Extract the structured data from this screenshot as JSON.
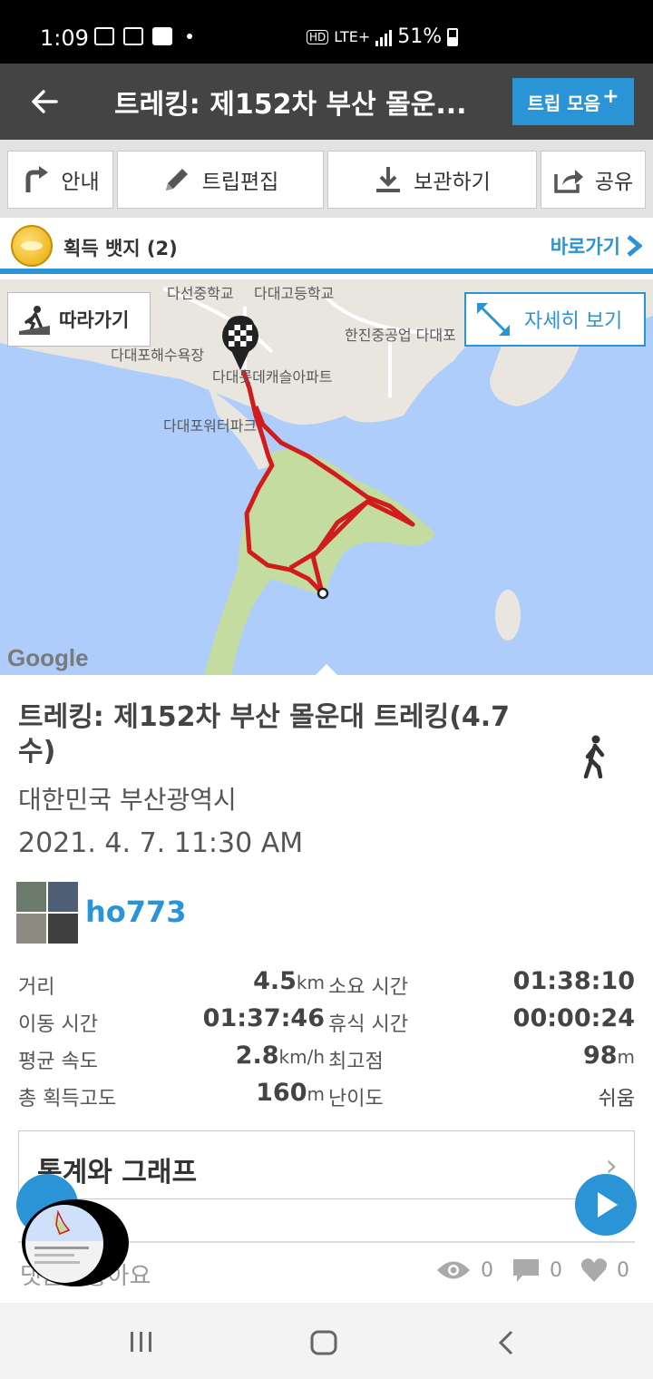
{
  "status": {
    "time": "1:09",
    "battery": "51%",
    "network": "LTE+",
    "hd": "HD"
  },
  "header": {
    "title": "트레킹: 제152차 부산 몰운...",
    "trip_collection": "트립 모음",
    "plus": "+"
  },
  "toolbar": {
    "guide": "안내",
    "edit": "트립편집",
    "save": "보관하기",
    "share": "공유"
  },
  "badges": {
    "label": "획득 뱃지 (2)",
    "goto": "바로가기"
  },
  "map": {
    "follow": "따라가기",
    "detail": "자세히 보기",
    "google": "Google",
    "labels": {
      "school1": "다선중학교",
      "school2": "다대고등학교",
      "beach": "다대포해수욕장",
      "factory": "한진중공업 다대포",
      "apartment": "다대롯데캐슬아파트",
      "pier": "다대포워터파크"
    },
    "colors": {
      "water": "#aecdfb",
      "land": "#e8e6df",
      "park": "#c5dca0",
      "route": "#d01c1c"
    }
  },
  "trip": {
    "title": "트레킹: 제152차 부산 몰운대 트레킹(4.7 수)",
    "location": "대한민국 부산광역시",
    "datetime": "2021. 4. 7. 11:30 AM",
    "user": "ho773",
    "activity_icon": "walker-icon"
  },
  "stats": {
    "distance_label": "거리",
    "distance_value": "4.5",
    "distance_unit": "km",
    "duration_label": "소요 시간",
    "duration_value": "01:38:10",
    "moving_label": "이동 시간",
    "moving_value": "01:37:46",
    "rest_label": "휴식 시간",
    "rest_value": "00:00:24",
    "speed_label": "평균 속도",
    "speed_value": "2.8",
    "speed_unit": "km/h",
    "max_alt_label": "최고점",
    "max_alt_value": "98",
    "max_alt_unit": "m",
    "gain_label": "총 획득고도",
    "gain_value": "160",
    "gain_unit": "m",
    "difficulty_label": "난이도",
    "difficulty_value": "쉬움"
  },
  "graph": {
    "label": "통계와 그래프",
    "chevron": "›"
  },
  "social": {
    "text": "댓글 · 좋아요",
    "views": "0",
    "comments": "0",
    "likes": "0"
  },
  "accent": "#2a94d6"
}
